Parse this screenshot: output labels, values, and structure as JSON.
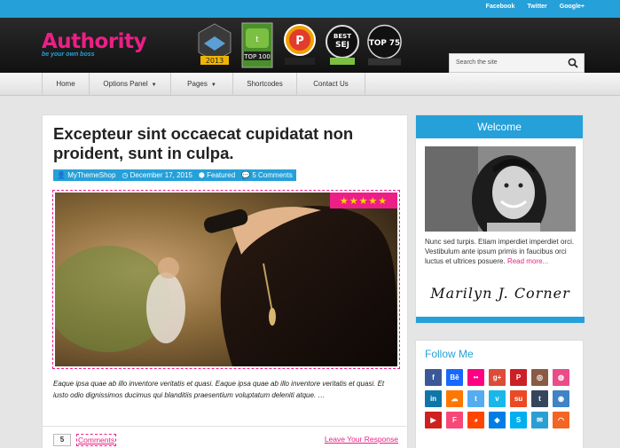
{
  "topbar": {
    "links": [
      "Facebook",
      "Twitter",
      "Google+"
    ]
  },
  "logo": {
    "title": "Authority",
    "tagline": "be your own boss"
  },
  "badges": [
    {
      "name": "top-affiliate-marketing-blog-badge",
      "text": "2013",
      "color": "#f0b400"
    },
    {
      "name": "technorati-top-100-badge",
      "text": "TOP 100",
      "color": "#7bc043"
    },
    {
      "name": "problogger-badge",
      "text": "P",
      "color": "#f0a000"
    },
    {
      "name": "best-of-sej-badge",
      "text": "SEJ",
      "color": "#ffffff"
    },
    {
      "name": "unbounce-top-75-badge",
      "text": "TOP 75",
      "color": "#ffffff"
    }
  ],
  "search": {
    "placeholder": "Search the site"
  },
  "nav": {
    "items": [
      {
        "label": "Home",
        "caret": ""
      },
      {
        "label": "Options Panel",
        "caret": "▼"
      },
      {
        "label": "Pages",
        "caret": "▼"
      },
      {
        "label": "Shortcodes",
        "caret": ""
      },
      {
        "label": "Contact Us",
        "caret": ""
      }
    ]
  },
  "post": {
    "title": "Excepteur sint occaecat cupidatat non proident, sunt in culpa.",
    "meta": {
      "author": "MyThemeShop",
      "date": "December 17, 2015",
      "category": "Featured",
      "comments": "5 Comments"
    },
    "rating": "★★★★★",
    "excerpt": "Eaque ipsa quae ab illo inventore veritatis et quasi. Eaque ipsa quae ab illo inventore veritatis et quasi. Et iusto odio dignissimos ducimus qui blanditiis praesentium voluptatum deleniti atque. …",
    "comment_count": "5",
    "comments_label": "Comments",
    "leave_response": "Leave Your Response"
  },
  "welcome": {
    "title": "Welcome",
    "bio": "Nunc sed turpis. Etiam imperdiet imperdiet orci. Vestibulum ante ipsum primis in faucibus orci luctus et ultrices posuere. ",
    "read_more": "Read more...",
    "signature": "Marilyn J. Corner"
  },
  "follow": {
    "title": "Follow Me",
    "icons": [
      {
        "name": "facebook-icon",
        "glyph": "f",
        "color": "#3b5998"
      },
      {
        "name": "behance-icon",
        "glyph": "Bē",
        "color": "#1769ff"
      },
      {
        "name": "flickr-icon",
        "glyph": "••",
        "color": "#ff0084"
      },
      {
        "name": "google-plus-icon",
        "glyph": "g+",
        "color": "#dd4b39"
      },
      {
        "name": "pinterest-icon",
        "glyph": "P",
        "color": "#cb2027"
      },
      {
        "name": "instagram-icon",
        "glyph": "◎",
        "color": "#8a5a44"
      },
      {
        "name": "dribbble-icon",
        "glyph": "◍",
        "color": "#ea4c89"
      },
      {
        "name": "linkedin-icon",
        "glyph": "in",
        "color": "#0e76a8"
      },
      {
        "name": "soundcloud-icon",
        "glyph": "☁",
        "color": "#ff7700"
      },
      {
        "name": "twitter-icon",
        "glyph": "t",
        "color": "#55acee"
      },
      {
        "name": "vimeo-icon",
        "glyph": "v",
        "color": "#1ab7ea"
      },
      {
        "name": "stumbleupon-icon",
        "glyph": "su",
        "color": "#eb4924"
      },
      {
        "name": "tumblr-icon",
        "glyph": "t",
        "color": "#35465c"
      },
      {
        "name": "github-icon",
        "glyph": "◉",
        "color": "#4183c4"
      },
      {
        "name": "youtube-icon",
        "glyph": "▶",
        "color": "#cd201f"
      },
      {
        "name": "foursquare-icon",
        "glyph": "F",
        "color": "#f94877"
      },
      {
        "name": "reddit-icon",
        "glyph": "◕",
        "color": "#ff4500"
      },
      {
        "name": "dropbox-icon",
        "glyph": "◆",
        "color": "#007ee5"
      },
      {
        "name": "skype-icon",
        "glyph": "S",
        "color": "#00aff0"
      },
      {
        "name": "email-icon",
        "glyph": "✉",
        "color": "#2a9fd6"
      },
      {
        "name": "rss-icon",
        "glyph": "◠",
        "color": "#f26522"
      }
    ]
  }
}
